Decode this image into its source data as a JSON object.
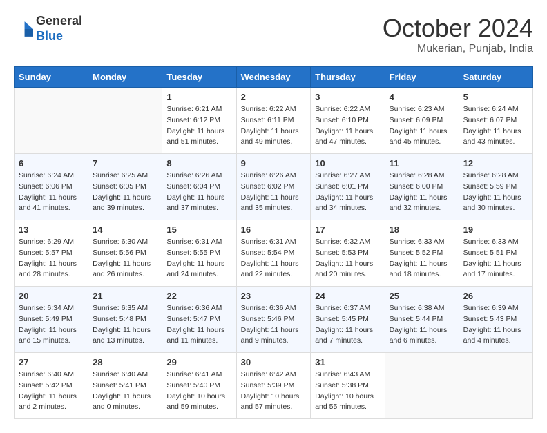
{
  "header": {
    "logo_general": "General",
    "logo_blue": "Blue",
    "month_title": "October 2024",
    "location": "Mukerian, Punjab, India"
  },
  "weekdays": [
    "Sunday",
    "Monday",
    "Tuesday",
    "Wednesday",
    "Thursday",
    "Friday",
    "Saturday"
  ],
  "weeks": [
    [
      {
        "day": "",
        "sunrise": "",
        "sunset": "",
        "daylight": ""
      },
      {
        "day": "",
        "sunrise": "",
        "sunset": "",
        "daylight": ""
      },
      {
        "day": "1",
        "sunrise": "Sunrise: 6:21 AM",
        "sunset": "Sunset: 6:12 PM",
        "daylight": "Daylight: 11 hours and 51 minutes."
      },
      {
        "day": "2",
        "sunrise": "Sunrise: 6:22 AM",
        "sunset": "Sunset: 6:11 PM",
        "daylight": "Daylight: 11 hours and 49 minutes."
      },
      {
        "day": "3",
        "sunrise": "Sunrise: 6:22 AM",
        "sunset": "Sunset: 6:10 PM",
        "daylight": "Daylight: 11 hours and 47 minutes."
      },
      {
        "day": "4",
        "sunrise": "Sunrise: 6:23 AM",
        "sunset": "Sunset: 6:09 PM",
        "daylight": "Daylight: 11 hours and 45 minutes."
      },
      {
        "day": "5",
        "sunrise": "Sunrise: 6:24 AM",
        "sunset": "Sunset: 6:07 PM",
        "daylight": "Daylight: 11 hours and 43 minutes."
      }
    ],
    [
      {
        "day": "6",
        "sunrise": "Sunrise: 6:24 AM",
        "sunset": "Sunset: 6:06 PM",
        "daylight": "Daylight: 11 hours and 41 minutes."
      },
      {
        "day": "7",
        "sunrise": "Sunrise: 6:25 AM",
        "sunset": "Sunset: 6:05 PM",
        "daylight": "Daylight: 11 hours and 39 minutes."
      },
      {
        "day": "8",
        "sunrise": "Sunrise: 6:26 AM",
        "sunset": "Sunset: 6:04 PM",
        "daylight": "Daylight: 11 hours and 37 minutes."
      },
      {
        "day": "9",
        "sunrise": "Sunrise: 6:26 AM",
        "sunset": "Sunset: 6:02 PM",
        "daylight": "Daylight: 11 hours and 35 minutes."
      },
      {
        "day": "10",
        "sunrise": "Sunrise: 6:27 AM",
        "sunset": "Sunset: 6:01 PM",
        "daylight": "Daylight: 11 hours and 34 minutes."
      },
      {
        "day": "11",
        "sunrise": "Sunrise: 6:28 AM",
        "sunset": "Sunset: 6:00 PM",
        "daylight": "Daylight: 11 hours and 32 minutes."
      },
      {
        "day": "12",
        "sunrise": "Sunrise: 6:28 AM",
        "sunset": "Sunset: 5:59 PM",
        "daylight": "Daylight: 11 hours and 30 minutes."
      }
    ],
    [
      {
        "day": "13",
        "sunrise": "Sunrise: 6:29 AM",
        "sunset": "Sunset: 5:57 PM",
        "daylight": "Daylight: 11 hours and 28 minutes."
      },
      {
        "day": "14",
        "sunrise": "Sunrise: 6:30 AM",
        "sunset": "Sunset: 5:56 PM",
        "daylight": "Daylight: 11 hours and 26 minutes."
      },
      {
        "day": "15",
        "sunrise": "Sunrise: 6:31 AM",
        "sunset": "Sunset: 5:55 PM",
        "daylight": "Daylight: 11 hours and 24 minutes."
      },
      {
        "day": "16",
        "sunrise": "Sunrise: 6:31 AM",
        "sunset": "Sunset: 5:54 PM",
        "daylight": "Daylight: 11 hours and 22 minutes."
      },
      {
        "day": "17",
        "sunrise": "Sunrise: 6:32 AM",
        "sunset": "Sunset: 5:53 PM",
        "daylight": "Daylight: 11 hours and 20 minutes."
      },
      {
        "day": "18",
        "sunrise": "Sunrise: 6:33 AM",
        "sunset": "Sunset: 5:52 PM",
        "daylight": "Daylight: 11 hours and 18 minutes."
      },
      {
        "day": "19",
        "sunrise": "Sunrise: 6:33 AM",
        "sunset": "Sunset: 5:51 PM",
        "daylight": "Daylight: 11 hours and 17 minutes."
      }
    ],
    [
      {
        "day": "20",
        "sunrise": "Sunrise: 6:34 AM",
        "sunset": "Sunset: 5:49 PM",
        "daylight": "Daylight: 11 hours and 15 minutes."
      },
      {
        "day": "21",
        "sunrise": "Sunrise: 6:35 AM",
        "sunset": "Sunset: 5:48 PM",
        "daylight": "Daylight: 11 hours and 13 minutes."
      },
      {
        "day": "22",
        "sunrise": "Sunrise: 6:36 AM",
        "sunset": "Sunset: 5:47 PM",
        "daylight": "Daylight: 11 hours and 11 minutes."
      },
      {
        "day": "23",
        "sunrise": "Sunrise: 6:36 AM",
        "sunset": "Sunset: 5:46 PM",
        "daylight": "Daylight: 11 hours and 9 minutes."
      },
      {
        "day": "24",
        "sunrise": "Sunrise: 6:37 AM",
        "sunset": "Sunset: 5:45 PM",
        "daylight": "Daylight: 11 hours and 7 minutes."
      },
      {
        "day": "25",
        "sunrise": "Sunrise: 6:38 AM",
        "sunset": "Sunset: 5:44 PM",
        "daylight": "Daylight: 11 hours and 6 minutes."
      },
      {
        "day": "26",
        "sunrise": "Sunrise: 6:39 AM",
        "sunset": "Sunset: 5:43 PM",
        "daylight": "Daylight: 11 hours and 4 minutes."
      }
    ],
    [
      {
        "day": "27",
        "sunrise": "Sunrise: 6:40 AM",
        "sunset": "Sunset: 5:42 PM",
        "daylight": "Daylight: 11 hours and 2 minutes."
      },
      {
        "day": "28",
        "sunrise": "Sunrise: 6:40 AM",
        "sunset": "Sunset: 5:41 PM",
        "daylight": "Daylight: 11 hours and 0 minutes."
      },
      {
        "day": "29",
        "sunrise": "Sunrise: 6:41 AM",
        "sunset": "Sunset: 5:40 PM",
        "daylight": "Daylight: 10 hours and 59 minutes."
      },
      {
        "day": "30",
        "sunrise": "Sunrise: 6:42 AM",
        "sunset": "Sunset: 5:39 PM",
        "daylight": "Daylight: 10 hours and 57 minutes."
      },
      {
        "day": "31",
        "sunrise": "Sunrise: 6:43 AM",
        "sunset": "Sunset: 5:38 PM",
        "daylight": "Daylight: 10 hours and 55 minutes."
      },
      {
        "day": "",
        "sunrise": "",
        "sunset": "",
        "daylight": ""
      },
      {
        "day": "",
        "sunrise": "",
        "sunset": "",
        "daylight": ""
      }
    ]
  ]
}
